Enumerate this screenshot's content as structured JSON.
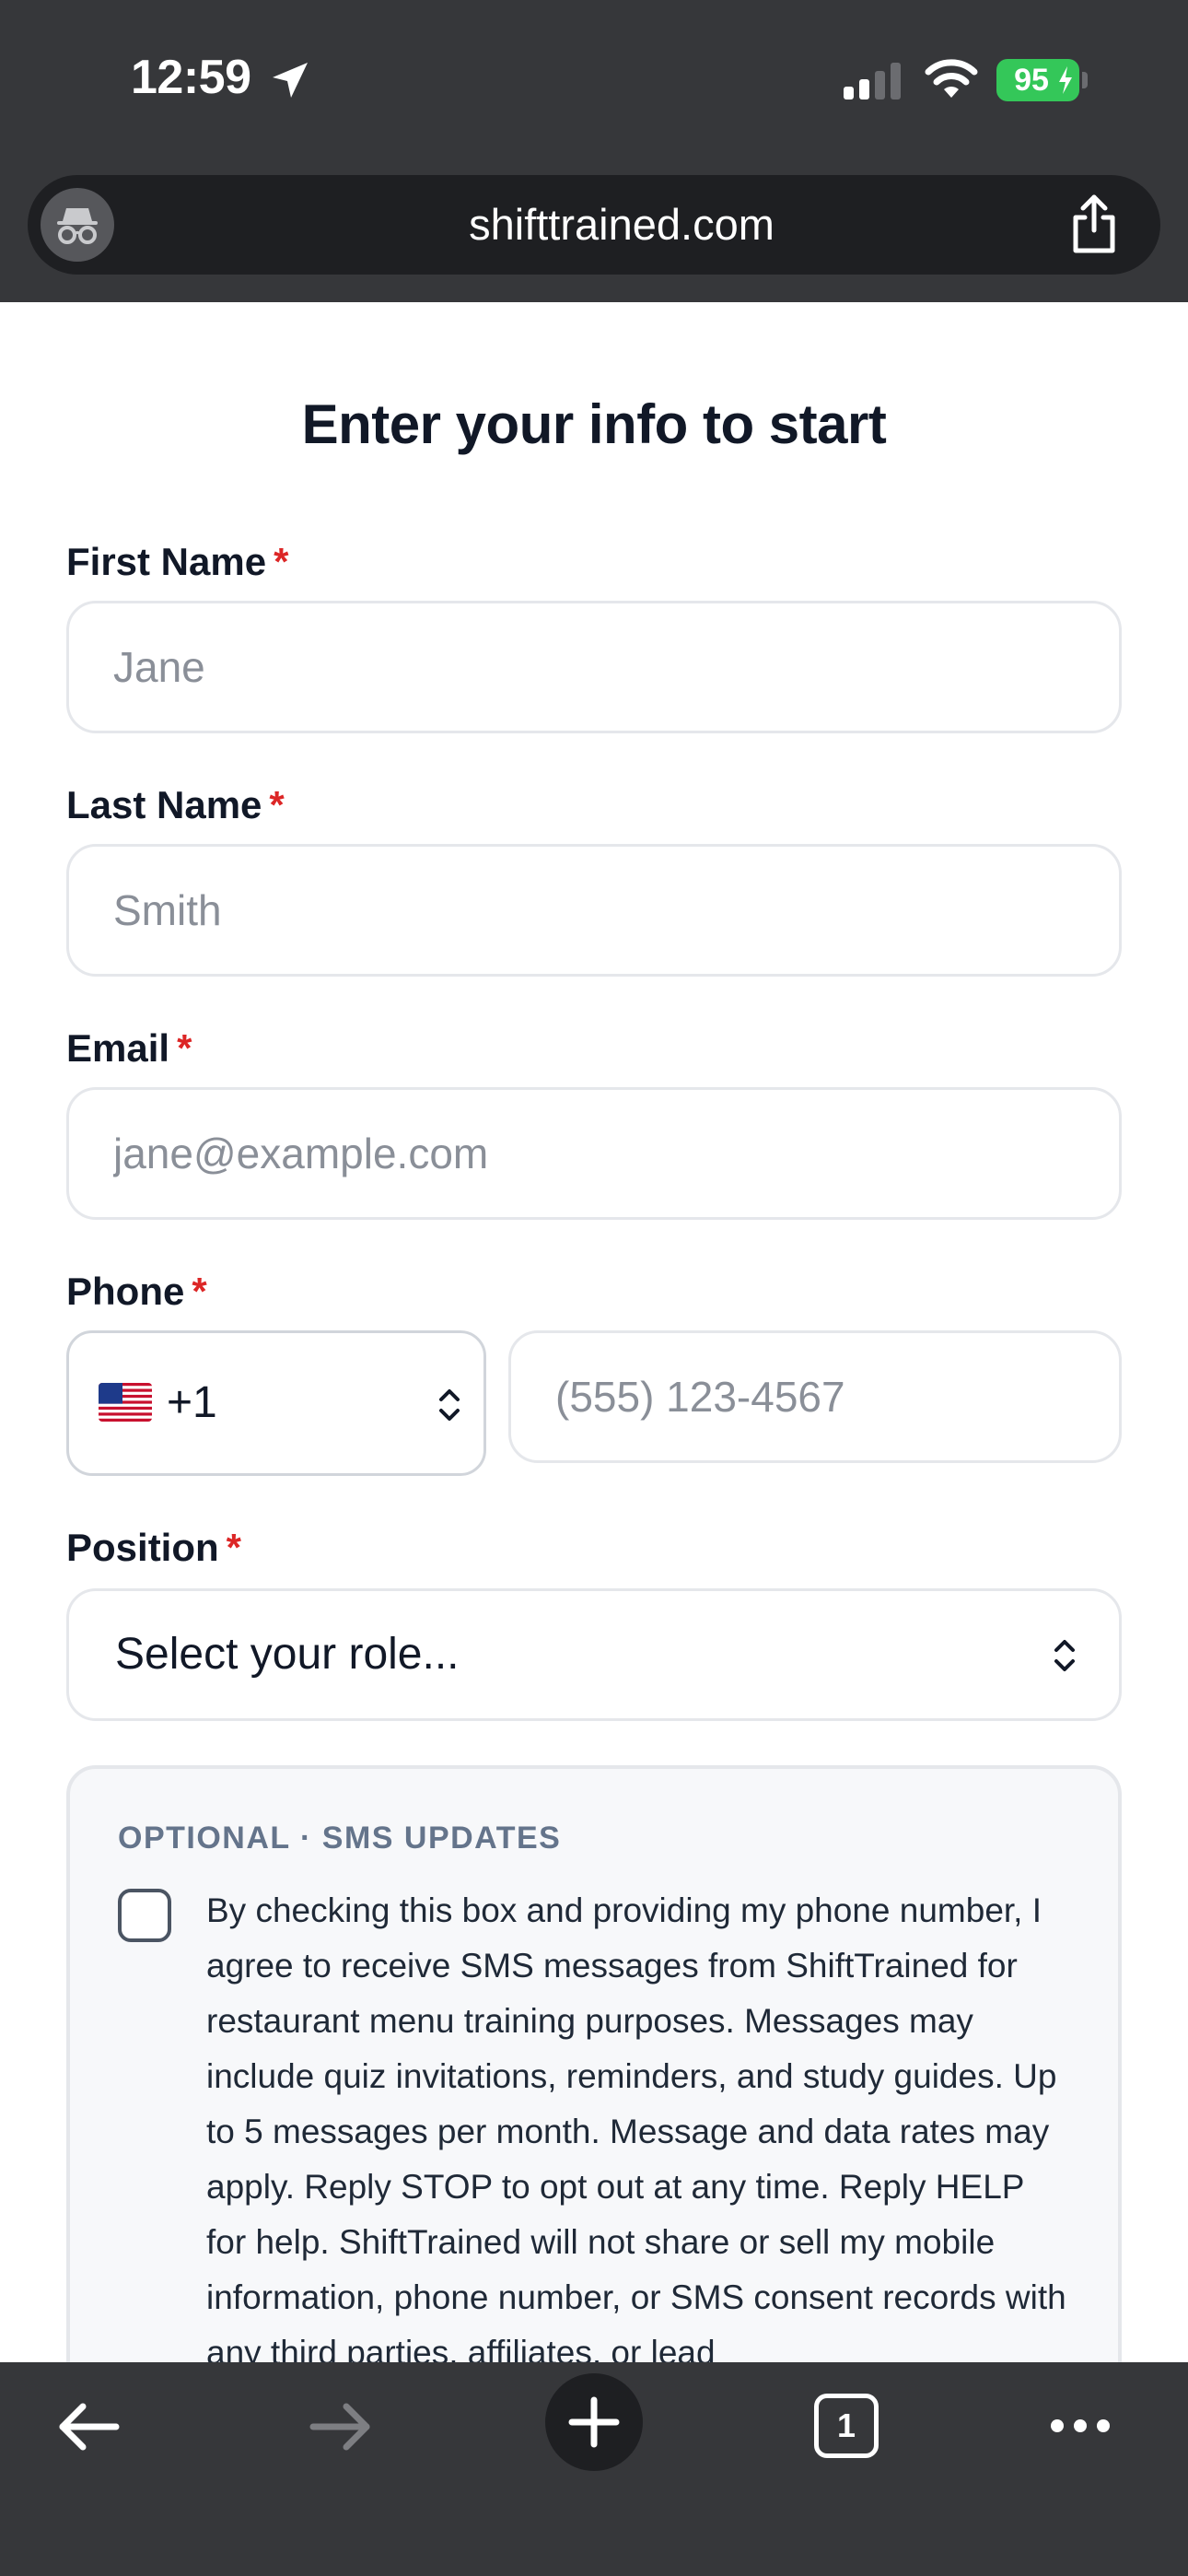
{
  "status_bar": {
    "time": "12:59",
    "battery": "95"
  },
  "browser": {
    "url": "shifttrained.com",
    "tab_count": "1"
  },
  "form": {
    "title": "Enter your info to start",
    "required_mark": "*",
    "first_name": {
      "label": "First Name",
      "placeholder": "Jane"
    },
    "last_name": {
      "label": "Last Name",
      "placeholder": "Smith"
    },
    "email": {
      "label": "Email",
      "placeholder": "jane@example.com"
    },
    "phone": {
      "label": "Phone",
      "country_code": "+1",
      "placeholder": "(555) 123-4567"
    },
    "position": {
      "label": "Position",
      "value": "Select your role..."
    },
    "sms": {
      "heading": "OPTIONAL · SMS UPDATES",
      "checked": false,
      "consent_text": "By checking this box and providing my phone number, I agree to receive SMS messages from ShiftTrained for restaurant menu training purposes. Messages may include quiz invitations, reminders, and study guides. Up to 5 messages per month. Message and data rates may apply. Reply STOP to opt out at any time. Reply HELP for help. ShiftTrained will not share or sell my mobile information, phone number, or SMS consent records with any third parties, affiliates, or lead"
    }
  },
  "icons": {
    "status": [
      "location-arrow-icon",
      "signal-icon",
      "wifi-icon",
      "battery-icon"
    ],
    "browser": [
      "incognito-icon",
      "share-icon"
    ],
    "toolbar": [
      "back-arrow-icon",
      "forward-arrow-icon",
      "plus-icon",
      "tabs-icon",
      "more-icon"
    ]
  },
  "colors": {
    "chrome_bg": "#36373a",
    "url_bar_bg": "#1e1f22",
    "required": "#dc2626",
    "battery": "#34c759",
    "sms_box_bg": "#f7f8fa"
  }
}
